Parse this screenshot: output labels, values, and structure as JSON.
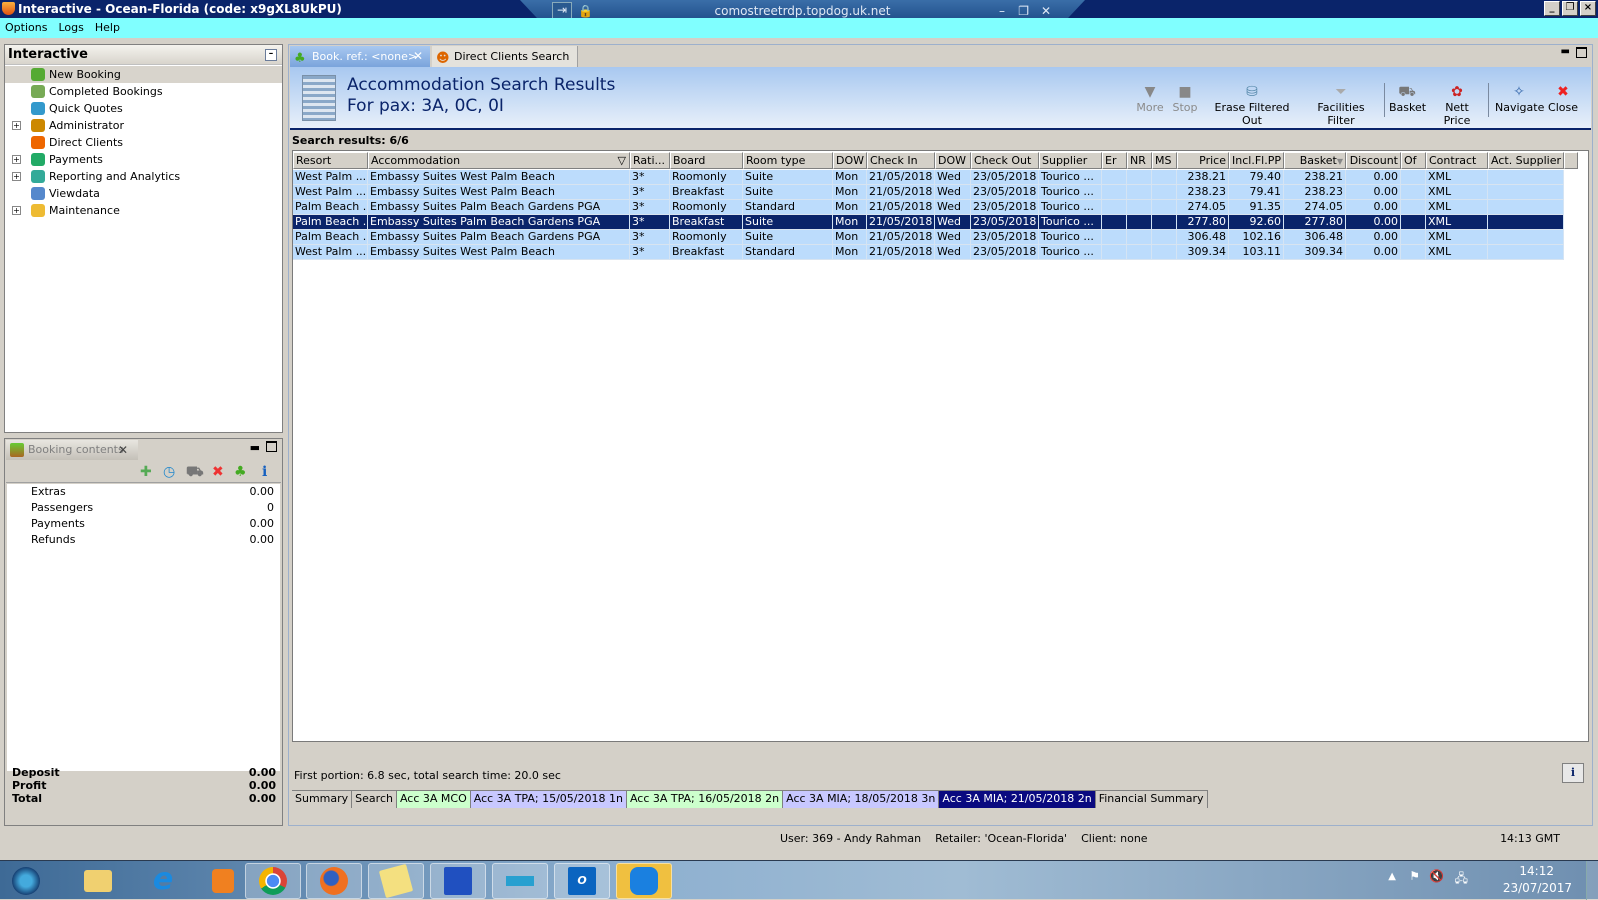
{
  "window": {
    "title": "Interactive - Ocean-Florida (code: x9gXL8UkPU)",
    "rdp_host": "comostreetrdp.topdog.uk.net"
  },
  "menu": [
    "Options",
    "Logs",
    "Help"
  ],
  "nav": {
    "title": "Interactive",
    "items": [
      {
        "label": "New Booking",
        "expandable": false,
        "icon": "palm-tree-icon",
        "selected": true
      },
      {
        "label": "Completed Bookings",
        "expandable": false,
        "icon": "palm-tree-suitcase-icon"
      },
      {
        "label": "Quick Quotes",
        "expandable": false,
        "icon": "clock-icon"
      },
      {
        "label": "Administrator",
        "expandable": true,
        "icon": "admin-icon"
      },
      {
        "label": "Direct Clients",
        "expandable": false,
        "icon": "client-icon"
      },
      {
        "label": "Payments",
        "expandable": true,
        "icon": "payments-icon"
      },
      {
        "label": "Reporting and Analytics",
        "expandable": true,
        "icon": "report-icon"
      },
      {
        "label": "Viewdata",
        "expandable": false,
        "icon": "globe-icon"
      },
      {
        "label": "Maintenance",
        "expandable": true,
        "icon": "maintenance-icon"
      }
    ]
  },
  "booking": {
    "tab": "Booking contents",
    "rows": [
      {
        "label": "Extras",
        "value": "0.00"
      },
      {
        "label": "Passengers",
        "value": "0"
      },
      {
        "label": "Payments",
        "value": "0.00"
      },
      {
        "label": "Refunds",
        "value": "0.00"
      }
    ],
    "totals": [
      {
        "label": "Deposit",
        "value": "0.00"
      },
      {
        "label": "Profit",
        "value": "0.00"
      },
      {
        "label": "Total",
        "value": "0.00"
      }
    ]
  },
  "tabs": [
    {
      "label": "Book. ref.: <none>",
      "active": true
    },
    {
      "label": "Direct Clients Search",
      "active": false
    }
  ],
  "header": {
    "title": "Accommodation Search Results",
    "subtitle": "For pax: 3A, 0C, 0I"
  },
  "toolbar": [
    {
      "label": "More",
      "icon": "triangle-down-icon",
      "enabled": false
    },
    {
      "label": "Stop",
      "icon": "stop-icon",
      "enabled": false
    },
    {
      "label": "Erase Filtered Out",
      "icon": "erase-icon",
      "enabled": true
    },
    {
      "label": "Facilities Filter",
      "icon": "funnel-icon",
      "enabled": true
    },
    {
      "label": "Basket",
      "icon": "basket-icon",
      "enabled": true
    },
    {
      "label": "Nett Price",
      "icon": "nett-price-icon",
      "enabled": true
    },
    {
      "label": "Navigate",
      "icon": "compass-icon",
      "enabled": true
    },
    {
      "label": "Close",
      "icon": "close-icon",
      "enabled": true
    }
  ],
  "results": {
    "label": "Search results: 6/6",
    "columns": [
      "Resort",
      "Accommodation",
      "Rati...",
      "Board",
      "Room type",
      "DOW",
      "Check In",
      "DOW",
      "Check Out",
      "Supplier",
      "Er",
      "NR",
      "MS",
      "Price",
      "Incl.Fl.PP",
      "Basket",
      "Discount",
      "Of",
      "Contract",
      "Act. Supplier"
    ],
    "rows": [
      [
        "West Palm ...",
        "Embassy Suites West Palm Beach",
        "3*",
        "Roomonly",
        "Suite",
        "Mon",
        "21/05/2018",
        "Wed",
        "23/05/2018",
        "Tourico ...",
        "",
        "",
        "",
        "238.21",
        "79.40",
        "238.21",
        "0.00",
        "",
        "XML",
        ""
      ],
      [
        "West Palm ...",
        "Embassy Suites West Palm Beach",
        "3*",
        "Breakfast",
        "Suite",
        "Mon",
        "21/05/2018",
        "Wed",
        "23/05/2018",
        "Tourico ...",
        "",
        "",
        "",
        "238.23",
        "79.41",
        "238.23",
        "0.00",
        "",
        "XML",
        ""
      ],
      [
        "Palm Beach ...",
        "Embassy Suites Palm Beach Gardens PGA",
        "3*",
        "Roomonly",
        "Standard",
        "Mon",
        "21/05/2018",
        "Wed",
        "23/05/2018",
        "Tourico ...",
        "",
        "",
        "",
        "274.05",
        "91.35",
        "274.05",
        "0.00",
        "",
        "XML",
        ""
      ],
      [
        "Palm Beach ...",
        "Embassy Suites Palm Beach Gardens PGA",
        "3*",
        "Breakfast",
        "Suite",
        "Mon",
        "21/05/2018",
        "Wed",
        "23/05/2018",
        "Tourico ...",
        "",
        "",
        "",
        "277.80",
        "92.60",
        "277.80",
        "0.00",
        "",
        "XML",
        ""
      ],
      [
        "Palm Beach ...",
        "Embassy Suites Palm Beach Gardens PGA",
        "3*",
        "Roomonly",
        "Suite",
        "Mon",
        "21/05/2018",
        "Wed",
        "23/05/2018",
        "Tourico ...",
        "",
        "",
        "",
        "306.48",
        "102.16",
        "306.48",
        "0.00",
        "",
        "XML",
        ""
      ],
      [
        "West Palm ...",
        "Embassy Suites West Palm Beach",
        "3*",
        "Breakfast",
        "Standard",
        "Mon",
        "21/05/2018",
        "Wed",
        "23/05/2018",
        "Tourico ...",
        "",
        "",
        "",
        "309.34",
        "103.11",
        "309.34",
        "0.00",
        "",
        "XML",
        ""
      ]
    ],
    "selected_row": 3
  },
  "status": "First portion: 6.8 sec, total search time: 20.0 sec",
  "bottom_tabs": [
    {
      "label": "Summary",
      "color": "#d4d0c8"
    },
    {
      "label": "Search",
      "color": "#d4d0c8"
    },
    {
      "label": "Acc 3A MCO",
      "color": "#ccffcc"
    },
    {
      "label": "Acc 3A TPA; 15/05/2018 1n",
      "color": "#c8c8ff"
    },
    {
      "label": "Acc 3A TPA; 16/05/2018 2n",
      "color": "#ccffcc"
    },
    {
      "label": "Acc 3A MIA; 18/05/2018 3n",
      "color": "#c8c8ff"
    },
    {
      "label": "Acc 3A MIA; 21/05/2018 2n",
      "color": "#0a0a80",
      "active": true
    },
    {
      "label": "Financial Summary",
      "color": "#d4d0c8"
    }
  ],
  "footer": {
    "user": "User: 369 - Andy Rahman",
    "retailer": "Retailer: 'Ocean-Florida'",
    "client": "Client: none",
    "time": "14:13 GMT"
  },
  "taskbar": {
    "time": "14:12",
    "date": "23/07/2017"
  }
}
